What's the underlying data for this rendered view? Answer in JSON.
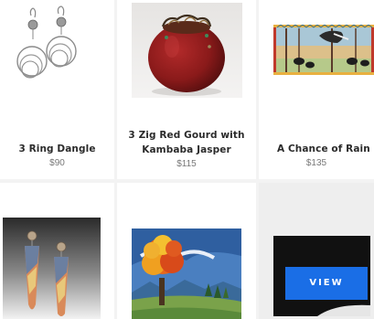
{
  "products": [
    {
      "title": "3 Ring Dangle",
      "price": "$90"
    },
    {
      "title_line1": "3 Zig Red Gourd with",
      "title_line2": "Kambaba Jasper",
      "price": "$115"
    },
    {
      "title": "A Chance of Rain",
      "price": "$135"
    }
  ],
  "hover": {
    "view_label": "VIEW"
  },
  "colors": {
    "accent": "#1a6ee6",
    "background": "#f3f3f3",
    "card": "#ffffff"
  }
}
